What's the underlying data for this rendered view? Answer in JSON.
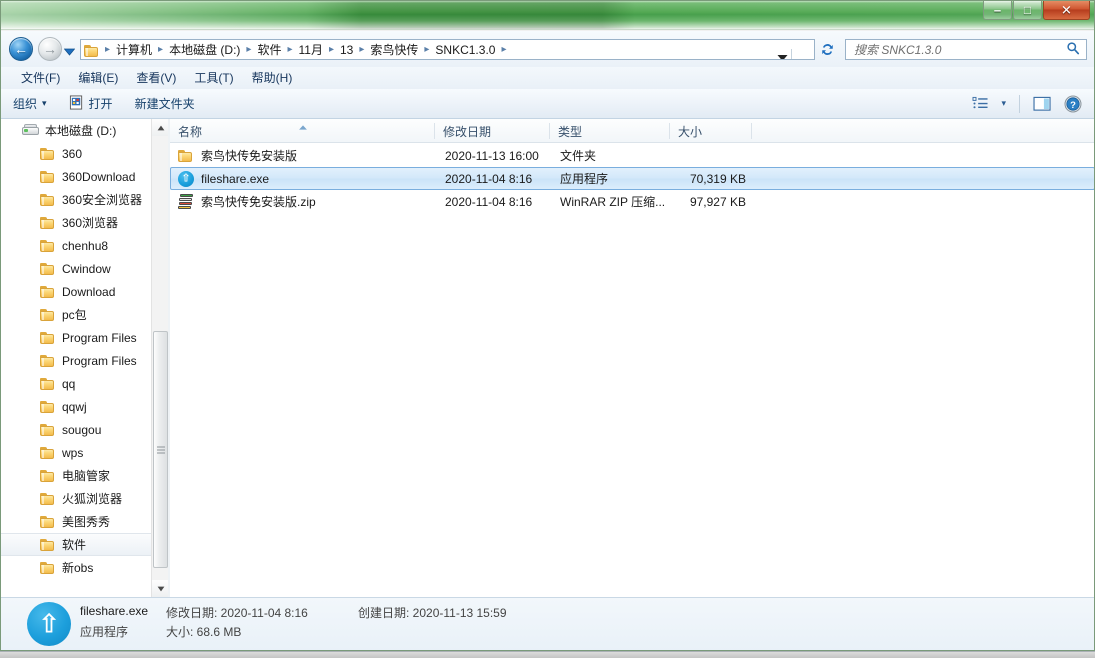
{
  "window": {
    "title": "",
    "controls": {
      "minimize_label": "–",
      "maximize_label": "□",
      "close_label": "✕"
    }
  },
  "navigation": {
    "back_label": "←",
    "forward_label": "→",
    "history_dropdown_label": "recent-pages-dropdown",
    "refresh_label": "refresh"
  },
  "address": {
    "breadcrumbs": [
      "计算机",
      "本地磁盘 (D:)",
      "软件",
      "11月",
      "13",
      "索鸟快传",
      "SNKC1.3.0"
    ],
    "separator": "▸",
    "trailing_separator": "▸"
  },
  "search": {
    "placeholder": "搜索 SNKC1.3.0",
    "value": ""
  },
  "menubar": {
    "items": [
      "文件(F)",
      "编辑(E)",
      "查看(V)",
      "工具(T)",
      "帮助(H)"
    ]
  },
  "toolbar": {
    "organize_label": "组织",
    "organize_caret": "▾",
    "open_label": "打开",
    "new_folder_label": "新建文件夹",
    "view_caret": "▾",
    "icons": {
      "open": "open-file-icon",
      "views": "change-view-icon",
      "preview": "preview-pane-icon",
      "help": "help-icon"
    }
  },
  "sidebar": {
    "root": {
      "label": "本地磁盘 (D:)",
      "icon": "hard-drive-icon"
    },
    "items": [
      {
        "label": "360",
        "selected": false
      },
      {
        "label": "360Download",
        "selected": false
      },
      {
        "label": "360安全浏览器",
        "selected": false
      },
      {
        "label": "360浏览器",
        "selected": false
      },
      {
        "label": "chenhu8",
        "selected": false
      },
      {
        "label": "Cwindow",
        "selected": false
      },
      {
        "label": "Download",
        "selected": false
      },
      {
        "label": "pc包",
        "selected": false
      },
      {
        "label": "Program Files",
        "selected": false
      },
      {
        "label": "Program Files",
        "selected": false
      },
      {
        "label": "qq",
        "selected": false
      },
      {
        "label": "qqwj",
        "selected": false
      },
      {
        "label": "sougou",
        "selected": false
      },
      {
        "label": "wps",
        "selected": false
      },
      {
        "label": "电脑管家",
        "selected": false
      },
      {
        "label": "火狐浏览器",
        "selected": false
      },
      {
        "label": "美图秀秀",
        "selected": false
      },
      {
        "label": "软件",
        "selected": true
      },
      {
        "label": "新obs",
        "selected": false
      }
    ],
    "scrollbar": {
      "up_arrow": "▲",
      "down_arrow": "▼"
    }
  },
  "filelist": {
    "columns": [
      {
        "key": "name",
        "label": "名称",
        "sorted": "asc"
      },
      {
        "key": "date",
        "label": "修改日期",
        "sorted": ""
      },
      {
        "key": "type",
        "label": "类型",
        "sorted": ""
      },
      {
        "key": "size",
        "label": "大小",
        "sorted": ""
      }
    ],
    "rows": [
      {
        "icon": "folder-icon",
        "name": "索鸟快传免安装版",
        "date": "2020-11-13 16:00",
        "type": "文件夹",
        "size": "",
        "selected": false
      },
      {
        "icon": "exe-icon",
        "name": "fileshare.exe",
        "date": "2020-11-04 8:16",
        "type": "应用程序",
        "size": "70,319 KB",
        "selected": true
      },
      {
        "icon": "zip-archive-icon",
        "name": "索鸟快传免安装版.zip",
        "date": "2020-11-04 8:16",
        "type": "WinRAR ZIP 压缩...",
        "size": "97,927 KB",
        "selected": false
      }
    ]
  },
  "statusbar": {
    "icon": "exe-icon",
    "filename": "fileshare.exe",
    "modified_label": "修改日期: 2020-11-04 8:16",
    "created_label": "创建日期: 2020-11-13 15:59",
    "filetype": "应用程序",
    "size_label": "大小: 68.6 MB"
  },
  "colors": {
    "titlebar_green": "#4aa44a",
    "selection_blue": "#cbe3f8",
    "selection_border": "#7aaede",
    "exe_icon_blue": "#1d9fdc",
    "folder_yellow": "#f3bc4c",
    "close_button_red": "#cf5530"
  }
}
